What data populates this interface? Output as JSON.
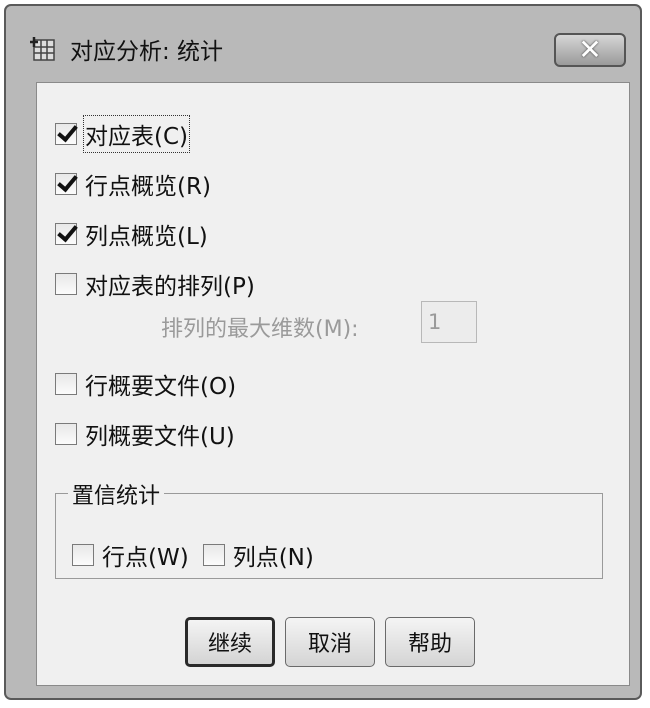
{
  "window": {
    "title": "对应分析: 统计",
    "close_label": "✕"
  },
  "options": [
    {
      "label": "对应表(C)",
      "checked": true
    },
    {
      "label": "行点概览(R)",
      "checked": true
    },
    {
      "label": "列点概览(L)",
      "checked": true
    },
    {
      "label": "对应表的排列(P)",
      "checked": false
    },
    {
      "label": "行概要文件(O)",
      "checked": false
    },
    {
      "label": "列概要文件(U)",
      "checked": false
    }
  ],
  "permutation": {
    "label": "排列的最大维数(M):",
    "value": "1"
  },
  "confidence": {
    "title": "置信统计",
    "items": [
      {
        "label": "行点(W)",
        "checked": false
      },
      {
        "label": "列点(N)",
        "checked": false
      }
    ]
  },
  "buttons": {
    "continue": "继续",
    "cancel": "取消",
    "help": "帮助"
  },
  "icons": {
    "app": "spss-table-icon",
    "close": "close-icon",
    "check": "checkmark-icon"
  }
}
